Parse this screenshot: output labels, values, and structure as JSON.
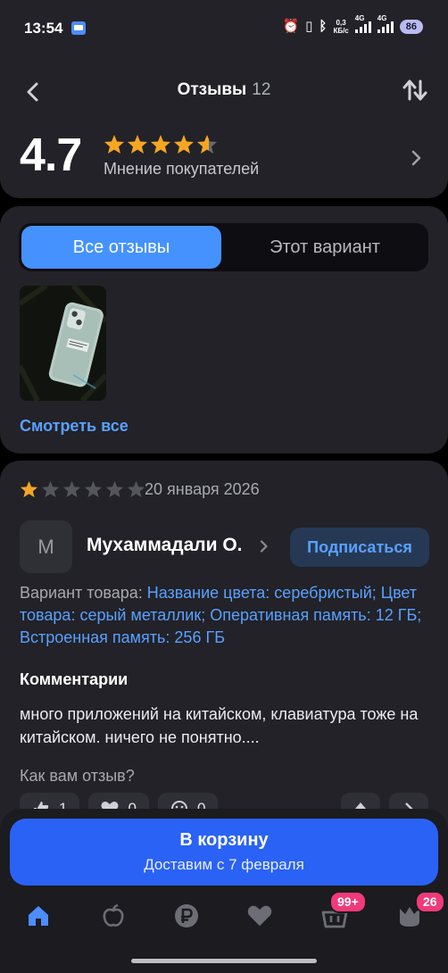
{
  "status_bar": {
    "time": "13:54",
    "speed_value": "0,3",
    "speed_unit": "КБ/с",
    "sim1": "4G",
    "sim2": "4G",
    "battery": "86"
  },
  "header": {
    "title": "Отзывы",
    "count": "12",
    "rating": "4.7",
    "rating_caption": "Мнение покупателей",
    "stars_filled": 4.7
  },
  "tabs": {
    "all": "Все отзывы",
    "variant": "Этот вариант"
  },
  "photos": {
    "see_all": "Смотреть все"
  },
  "review": {
    "stars": 1,
    "date": "20 января 2026",
    "avatar_letter": "М",
    "author": "Мухаммадали О.",
    "subscribe": "Подписаться",
    "variant_label": "Вариант товара: ",
    "variant_value": "Название цвета: серебристый; Цвет товара: серый металлик; Оперативная память: 12 ГБ; Встроенная память: 256 ГБ",
    "comments_heading": "Комментарии",
    "comment": "много приложений на китайском, клавиатура тоже на китайском. ничего не понятно....",
    "helpful_question": "Как вам отзыв?",
    "likes": "1",
    "hearts": "0",
    "dislikes": "0"
  },
  "cart": {
    "title": "В корзину",
    "subtitle": "Доставим с 7 февраля"
  },
  "nav": {
    "cart_badge": "99+",
    "profile_badge": "26"
  },
  "colors": {
    "accent": "#4592ff",
    "star": "#f5a623",
    "cart": "#2a62f5",
    "badge": "#f03a7a"
  }
}
